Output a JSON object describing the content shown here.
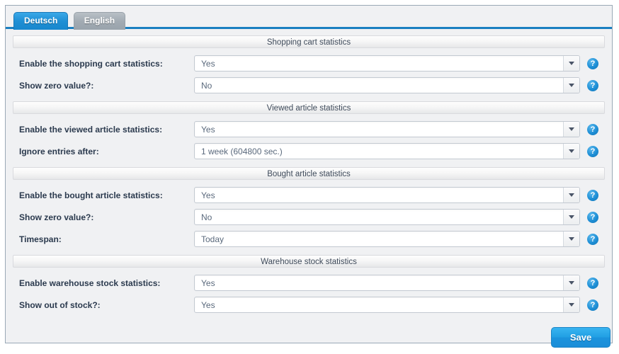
{
  "tabs": [
    {
      "label": "Deutsch",
      "active": true
    },
    {
      "label": "English",
      "active": false
    }
  ],
  "sections": [
    {
      "title": "Shopping cart statistics",
      "rows": [
        {
          "label": "Enable the shopping cart statistics:",
          "value": "Yes",
          "help": "?"
        },
        {
          "label": "Show zero value?:",
          "value": "No",
          "help": "?"
        }
      ]
    },
    {
      "title": "Viewed article statistics",
      "rows": [
        {
          "label": "Enable the viewed article statistics:",
          "value": "Yes",
          "help": "?"
        },
        {
          "label": "Ignore entries after:",
          "value": "1 week (604800 sec.)",
          "help": "?"
        }
      ]
    },
    {
      "title": "Bought article statistics",
      "rows": [
        {
          "label": "Enable the bought article statistics:",
          "value": "Yes",
          "help": "?"
        },
        {
          "label": "Show zero value?:",
          "value": "No",
          "help": "?"
        },
        {
          "label": "Timespan:",
          "value": "Today",
          "help": "?"
        }
      ]
    },
    {
      "title": "Warehouse stock statistics",
      "rows": [
        {
          "label": "Enable warehouse stock statistics:",
          "value": "Yes",
          "help": "?"
        },
        {
          "label": "Show out of stock?:",
          "value": "Yes",
          "help": "?"
        }
      ]
    }
  ],
  "footer": {
    "save_label": "Save"
  },
  "colors": {
    "accent": "#1f8fd4",
    "tab_active": "#2296dc",
    "tab_inactive": "#a2abb3",
    "panel_bg": "#f0f1f3",
    "panel_border": "#9aa9b6",
    "label_text": "#2b3a4e",
    "value_text": "#5a697c",
    "help_icon": "#1e8fd6",
    "save_button": "#22a0e4"
  }
}
